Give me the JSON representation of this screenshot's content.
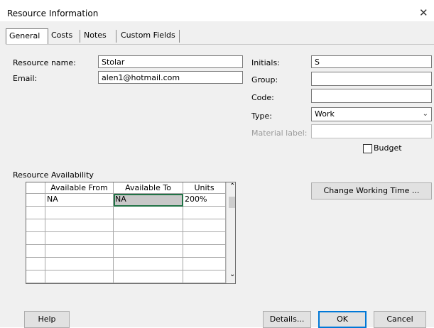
{
  "window": {
    "title": "Resource Information",
    "close_glyph": "✕"
  },
  "tabs": [
    {
      "label": "General",
      "active": true
    },
    {
      "label": "Costs",
      "active": false
    },
    {
      "label": "Notes",
      "active": false
    },
    {
      "label": "Custom Fields",
      "active": false
    }
  ],
  "general": {
    "resource_name_label": "Resource name:",
    "resource_name_value": "Stolar",
    "email_label": "Email:",
    "email_value": "alen1@hotmail.com",
    "initials_label": "Initials:",
    "initials_value": "S",
    "group_label": "Group:",
    "group_value": "",
    "code_label": "Code:",
    "code_value": "",
    "type_label": "Type:",
    "type_value": "Work",
    "material_label": "Material label:",
    "material_value": "",
    "budget_label": "Budget",
    "budget_checked": false
  },
  "availability": {
    "section_label": "Resource Availability",
    "columns": [
      "Available From",
      "Available To",
      "Units"
    ],
    "rows": [
      {
        "from": "NA",
        "to": "NA",
        "units": "200%"
      }
    ],
    "empty_rows": 6
  },
  "buttons": {
    "change_working_time": "Change Working Time ...",
    "help": "Help",
    "details": "Details...",
    "ok": "OK",
    "cancel": "Cancel"
  },
  "icons": {
    "close": "close-icon",
    "dropdown": "chevron-down-icon",
    "scroll_up": "chevron-up-icon",
    "scroll_down": "chevron-down-icon"
  }
}
